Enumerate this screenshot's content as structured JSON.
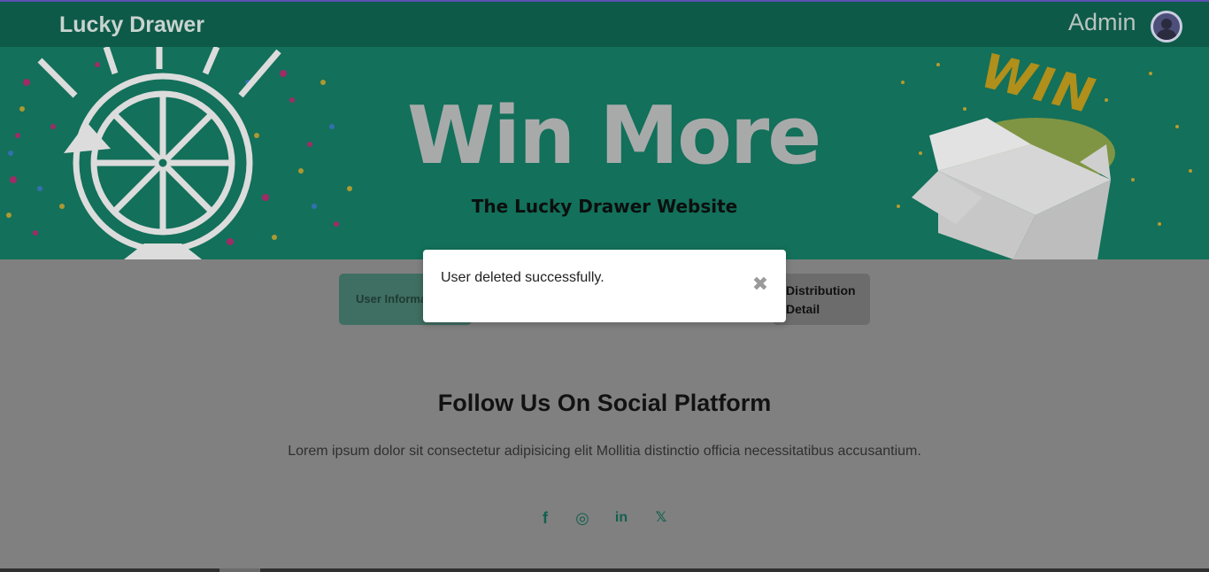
{
  "navbar": {
    "brand": "Lucky Drawer",
    "user_label": "Admin"
  },
  "banner": {
    "title": "Win More",
    "subtitle": "The Lucky Drawer Website",
    "badge": "WIN"
  },
  "tabs": {
    "active_label": "User Information",
    "right_label_line1": "Distribution",
    "right_label_line2": "Detail"
  },
  "follow": {
    "title": "Follow Us On Social Platform",
    "text": "Lorem ipsum dolor sit consectetur adipisicing elit Mollitia distinctio officia necessitatibus accusantium."
  },
  "socials": [
    {
      "icon": "facebook-icon",
      "glyph": "f"
    },
    {
      "icon": "instagram-icon",
      "glyph": "◎"
    },
    {
      "icon": "linkedin-icon",
      "glyph": "in"
    },
    {
      "icon": "x-icon",
      "glyph": "𝕏"
    }
  ],
  "toast": {
    "message": "User deleted successfully.",
    "close_glyph": "✖"
  },
  "colors": {
    "navbar": "#0d5a48",
    "banner": "#13705a",
    "accent": "#14604f"
  }
}
